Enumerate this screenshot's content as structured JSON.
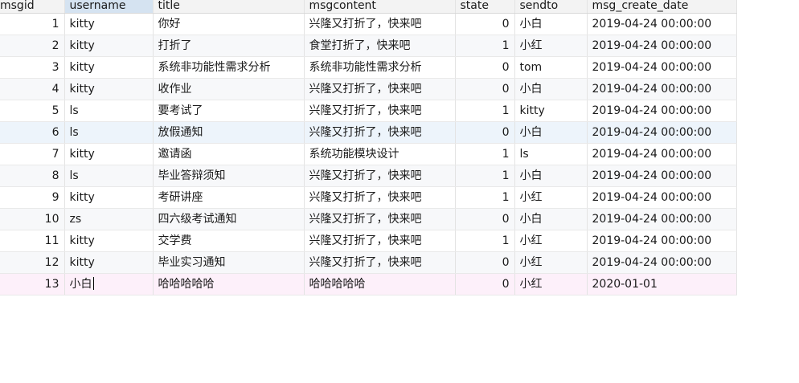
{
  "columns": [
    {
      "key": "msgid",
      "label": "msgid"
    },
    {
      "key": "username",
      "label": "username"
    },
    {
      "key": "title",
      "label": "title"
    },
    {
      "key": "msgcontent",
      "label": "msgcontent"
    },
    {
      "key": "state",
      "label": "state"
    },
    {
      "key": "sendto",
      "label": "sendto"
    },
    {
      "key": "msg_create_date",
      "label": "msg_create_date"
    }
  ],
  "rows": [
    {
      "msgid": "1",
      "username": "kitty",
      "title": "你好",
      "msgcontent": "兴隆又打折了，快来吧",
      "state": "0",
      "sendto": "小白",
      "msg_create_date": "2019-04-24 00:00:00"
    },
    {
      "msgid": "2",
      "username": "kitty",
      "title": "打折了",
      "msgcontent": "食堂打折了，快来吧",
      "state": "1",
      "sendto": "小红",
      "msg_create_date": "2019-04-24 00:00:00"
    },
    {
      "msgid": "3",
      "username": "kitty",
      "title": "系统非功能性需求分析",
      "msgcontent": "系统非功能性需求分析",
      "state": "0",
      "sendto": "tom",
      "msg_create_date": "2019-04-24 00:00:00"
    },
    {
      "msgid": "4",
      "username": "kitty",
      "title": "收作业",
      "msgcontent": "兴隆又打折了，快来吧",
      "state": "0",
      "sendto": "小白",
      "msg_create_date": "2019-04-24 00:00:00"
    },
    {
      "msgid": "5",
      "username": "ls",
      "title": "要考试了",
      "msgcontent": "兴隆又打折了，快来吧",
      "state": "1",
      "sendto": "kitty",
      "msg_create_date": "2019-04-24 00:00:00"
    },
    {
      "msgid": "6",
      "username": "ls",
      "title": "放假通知",
      "msgcontent": "兴隆又打折了，快来吧",
      "state": "0",
      "sendto": "小白",
      "msg_create_date": "2019-04-24 00:00:00"
    },
    {
      "msgid": "7",
      "username": "kitty",
      "title": "邀请函",
      "msgcontent": "系统功能模块设计",
      "state": "1",
      "sendto": "ls",
      "msg_create_date": "2019-04-24 00:00:00"
    },
    {
      "msgid": "8",
      "username": "ls",
      "title": "毕业答辩须知",
      "msgcontent": "兴隆又打折了，快来吧",
      "state": "1",
      "sendto": "小白",
      "msg_create_date": "2019-04-24 00:00:00"
    },
    {
      "msgid": "9",
      "username": "kitty",
      "title": "考研讲座",
      "msgcontent": "兴隆又打折了，快来吧",
      "state": "1",
      "sendto": "小红",
      "msg_create_date": "2019-04-24 00:00:00"
    },
    {
      "msgid": "10",
      "username": "zs",
      "title": "四六级考试通知",
      "msgcontent": "兴隆又打折了，快来吧",
      "state": "0",
      "sendto": "小白",
      "msg_create_date": "2019-04-24 00:00:00"
    },
    {
      "msgid": "11",
      "username": "kitty",
      "title": "交学费",
      "msgcontent": "兴隆又打折了，快来吧",
      "state": "1",
      "sendto": "小红",
      "msg_create_date": "2019-04-24 00:00:00"
    },
    {
      "msgid": "12",
      "username": "kitty",
      "title": "毕业实习通知",
      "msgcontent": "兴隆又打折了，快来吧",
      "state": "0",
      "sendto": "小红",
      "msg_create_date": "2019-04-24 00:00:00"
    },
    {
      "msgid": "13",
      "username": "小白",
      "title": "哈哈哈哈哈",
      "msgcontent": "哈哈哈哈哈",
      "state": "0",
      "sendto": "小红",
      "msg_create_date": "2020-01-01"
    }
  ],
  "active_column": "username",
  "highlighted_row": "6",
  "editing_row": "13",
  "editing_column": "username",
  "colors": {
    "header_bg": "#f3f3f3",
    "active_header_bg": "#d5e3f1",
    "highlight_row_bg": "#edf4fb",
    "editing_row_bg": "#fdf0fa"
  }
}
